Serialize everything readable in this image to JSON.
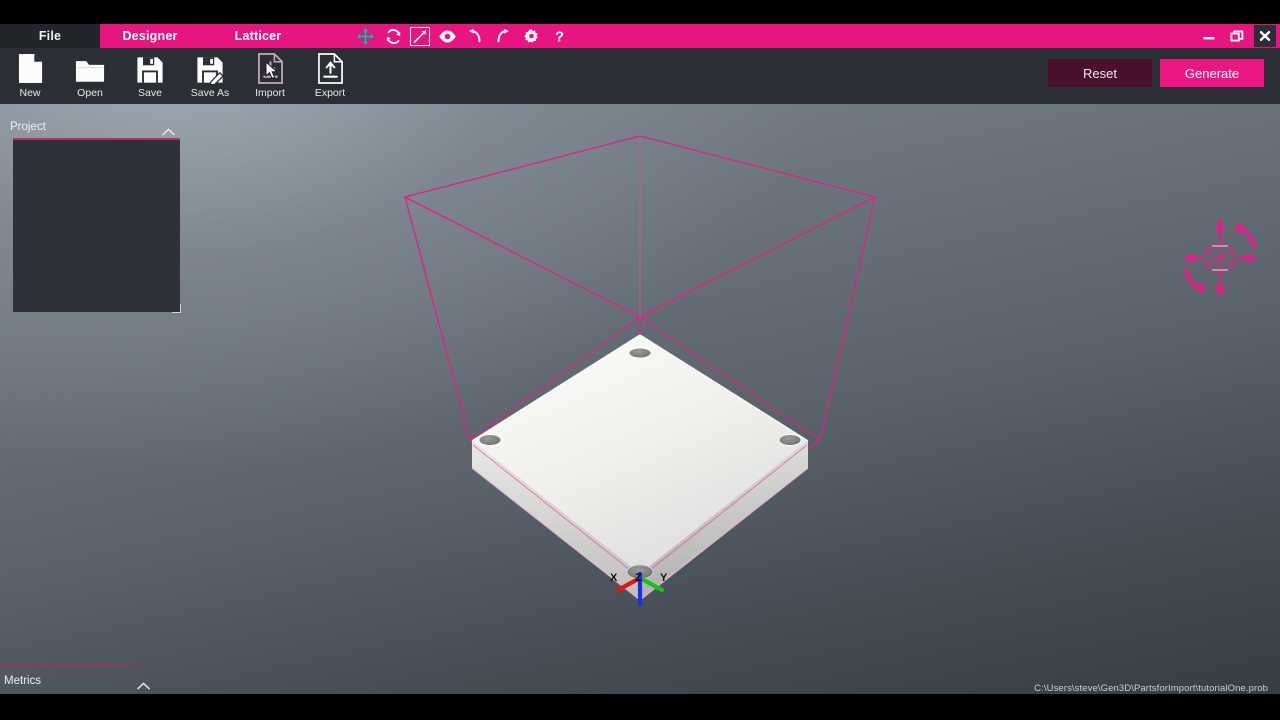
{
  "window": {
    "controls": [
      {
        "name": "minimize",
        "glyph": "minimize-icon"
      },
      {
        "name": "restore",
        "glyph": "restore-icon"
      },
      {
        "name": "close",
        "glyph": "close-icon"
      }
    ]
  },
  "menubar": {
    "tabs": [
      {
        "label": "File",
        "active": true
      },
      {
        "label": "Designer",
        "active": false
      },
      {
        "label": "Latticer",
        "active": false
      }
    ],
    "tool_icons": [
      {
        "name": "move-icon",
        "title": "Move",
        "active": true,
        "color": "#2bb3ae"
      },
      {
        "name": "rotate-icon",
        "title": "Rotate",
        "active": false,
        "color": "#ffffff"
      },
      {
        "name": "measure-icon",
        "title": "Measure",
        "active": false,
        "color": "#ffffff"
      },
      {
        "name": "visibility-eye-icon",
        "title": "Visibility",
        "active": false,
        "color": "#ffffff"
      },
      {
        "name": "undo-icon",
        "title": "Undo",
        "active": false,
        "color": "#ffffff"
      },
      {
        "name": "redo-icon",
        "title": "Redo",
        "active": false,
        "color": "#ffffff"
      },
      {
        "name": "gear-icon",
        "title": "Settings",
        "active": false,
        "color": "#ffffff"
      },
      {
        "name": "help-icon",
        "title": "Help",
        "active": false,
        "color": "#ffffff"
      }
    ]
  },
  "ribbon": {
    "buttons": [
      {
        "label": "New",
        "icon": "new-file-icon",
        "hovered": false
      },
      {
        "label": "Open",
        "icon": "open-folder-icon",
        "hovered": false
      },
      {
        "label": "Save",
        "icon": "save-floppy-icon",
        "hovered": false
      },
      {
        "label": "Save As",
        "icon": "save-as-floppy-icon",
        "hovered": false
      },
      {
        "label": "Import",
        "icon": "import-down-arrow-icon",
        "hovered": true
      },
      {
        "label": "Export",
        "icon": "export-up-arrow-icon",
        "hovered": false
      }
    ],
    "reset_label": "Reset",
    "generate_label": "Generate"
  },
  "panels": {
    "project": {
      "title": "Project",
      "collapse_icon": "chevron-up-icon",
      "content": ""
    },
    "metrics": {
      "title": "Metrics",
      "collapse_icon": "chevron-up-icon"
    }
  },
  "viewport": {
    "axis_labels": {
      "x": "X",
      "y": "Y",
      "z": "Z"
    },
    "axis_colors": {
      "x": "#e01616",
      "y": "#17c217",
      "z": "#1a2fe0"
    },
    "nav_gizmo": "orbit-navigation-gizmo-icon",
    "bounding_box_color": "#e0208a",
    "part_color": "#f2f2ee",
    "cursor": "mouse-pointer-icon"
  },
  "statusbar": {
    "file_path": "C:\\Users\\steve\\Gen3D\\PartsforImport\\tutorialOne.prob"
  },
  "theme": {
    "accent": "#e6157f",
    "accent_bright": "#ec1680",
    "reset_bg": "#4a1030",
    "ribbon_bg": "#2b2f35",
    "panel_bg": "#2e3238",
    "panel_rule": "#b5306e"
  }
}
